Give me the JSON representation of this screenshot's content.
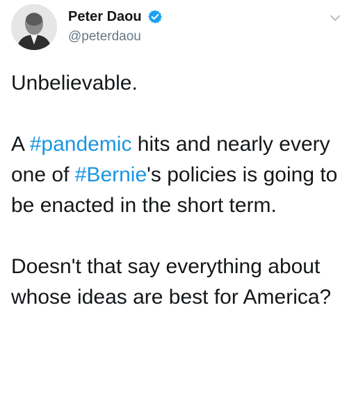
{
  "tweet": {
    "author": {
      "display_name": "Peter Daou",
      "handle": "@peterdaou",
      "verified": true,
      "avatar_icon": "person-portrait-avatar",
      "verified_icon": "verified-badge-icon"
    },
    "menu_icon": "chevron-down-icon",
    "text": {
      "p1": "Unbelievable.",
      "p2_a": "A ",
      "p2_hashtag1": "#pandemic",
      "p2_b": " hits and nearly every one of ",
      "p2_hashtag2": "#Bernie",
      "p2_c": "'s policies is going to be enacted in the short term.",
      "p3": "Doesn't that say everything about whose ideas are best for America?"
    },
    "colors": {
      "text": "#14171a",
      "handle": "#657786",
      "hashtag": "#1b95e0",
      "verified": "#1da1f2"
    }
  }
}
